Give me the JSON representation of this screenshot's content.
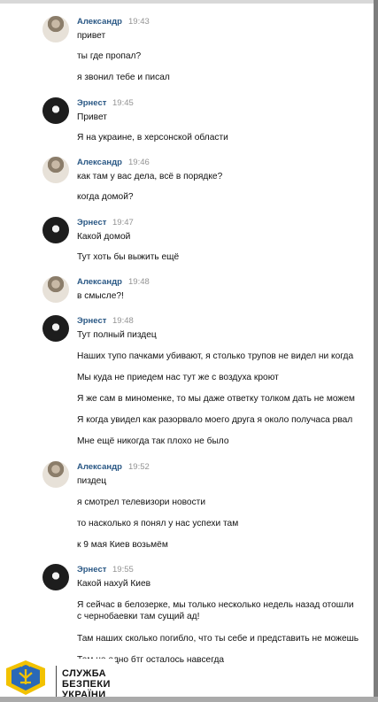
{
  "messages": [
    {
      "author": "Александр",
      "time": "19:43",
      "lines": [
        "привет",
        "ты где пропал?",
        "я звонил тебе и писал"
      ]
    },
    {
      "author": "Эрнест",
      "time": "19:45",
      "lines": [
        "Привет",
        "Я на украине, в херсонской области"
      ]
    },
    {
      "author": "Александр",
      "time": "19:46",
      "lines": [
        "как там у вас дела, всё в порядке?",
        "когда домой?"
      ]
    },
    {
      "author": "Эрнест",
      "time": "19:47",
      "lines": [
        "Какой домой",
        "Тут хоть бы выжить ещё"
      ]
    },
    {
      "author": "Александр",
      "time": "19:48",
      "lines": [
        "в смысле?!"
      ]
    },
    {
      "author": "Эрнест",
      "time": "19:48",
      "lines": [
        "Тут полный пиздец",
        "Наших тупо пачками убивают, я столько трупов не видел ни когда",
        "Мы куда не приедем нас тут же с воздуха кроют",
        "Я же сам в миноменке, то мы даже ответку толком дать не можем",
        "Я когда увидел как разорвало моего друга я около получаса рвал",
        "Мне ещё никогда так плохо не было"
      ]
    },
    {
      "author": "Александр",
      "time": "19:52",
      "lines": [
        "пиздец",
        "я смотрел телевизори новости",
        "то насколько я понял у нас успехи там",
        "к 9 мая Киев возьмём"
      ]
    },
    {
      "author": "Эрнест",
      "time": "19:55",
      "lines": [
        "Какой нахуй Киев",
        "Я сейчас в белозерке, мы только несколько недель назад отошли",
        "с чернобаевки там сущий ад!",
        "Там наших сколько погибло, что ты себе и представить не можешь",
        "Там не одно бтг осталось навсегда"
      ]
    }
  ],
  "watermark": {
    "line1": "СЛУЖБА",
    "line2": "БЕЗПЕКИ",
    "line3": "УКРАЇНИ"
  }
}
